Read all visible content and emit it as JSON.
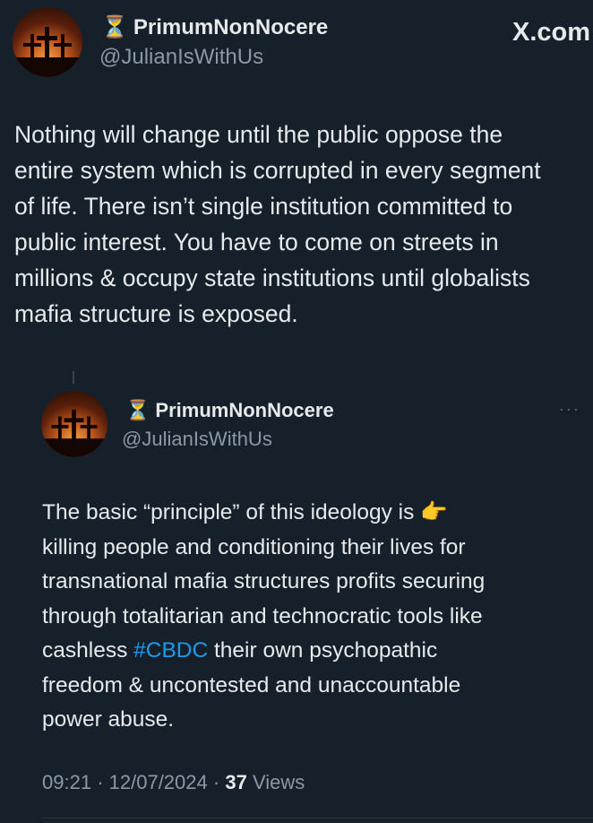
{
  "tweet": {
    "display_name": "PrimumNonNocere",
    "hourglass_icon": "⏳",
    "handle": "@JulianIsWithUs",
    "brand": "X.com",
    "text_lines": [
      "Nothing will change until the public oppose the",
      "entire system which is corrupted in every segment",
      "of life. There isn’t single institution committed to",
      "public interest. You have to come on streets in",
      "millions & occupy state institutions until globalists",
      "mafia structure is exposed."
    ]
  },
  "quoted": {
    "display_name": "PrimumNonNocere",
    "hourglass_icon": "⏳",
    "handle": "@JulianIsWithUs",
    "more_label": "···",
    "text_lines": [
      "The basic “principle” of this ideology is 👉",
      "killing people and conditioning their lives for",
      "transnational mafia structures profits securing",
      "through totalitarian and technocratic tools like",
      "cashless ",
      " their own psychopathic",
      "freedom & uncontested and unaccountable",
      "power abuse."
    ],
    "hashtag": "#CBDC",
    "time": "09:21",
    "dot": "·",
    "date": "12/07/2024",
    "views_count": "37",
    "views_label": "Views"
  },
  "colors": {
    "background": "#15202b",
    "text": "#e7e9ea",
    "secondary": "#8b98a5",
    "link": "#1d9bf0"
  }
}
